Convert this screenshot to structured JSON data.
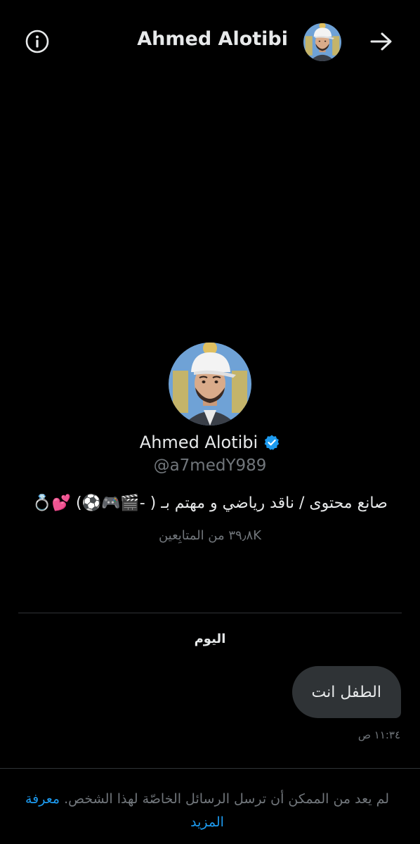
{
  "header": {
    "title": "Ahmed Alotibi",
    "info_icon": "info-circle-icon",
    "back_icon": "arrow-right-icon"
  },
  "profile": {
    "name": "Ahmed Alotibi",
    "handle": "@a7medY989",
    "verified": true,
    "bio": "صانع محتوى / ناقد رياضي و مهتم بـ ( -🎬🎮⚽️) 💕💍",
    "followers": "٣٩٫٨K من المتابِعين"
  },
  "conversation": {
    "day_label": "اليوم",
    "messages": [
      {
        "text": "الطفل انت",
        "time": "١١:٣٤ ص",
        "outgoing": true
      }
    ]
  },
  "footer": {
    "notice": "لم يعد من الممكن أن ترسل الرسائل الخاصّة لهذا الشخص.",
    "learn_more": "معرفة المزيد"
  },
  "colors": {
    "background": "#000000",
    "text": "#e7e9ea",
    "muted": "#71767b",
    "bubble": "#2f3336",
    "accent": "#1d9bf0"
  }
}
